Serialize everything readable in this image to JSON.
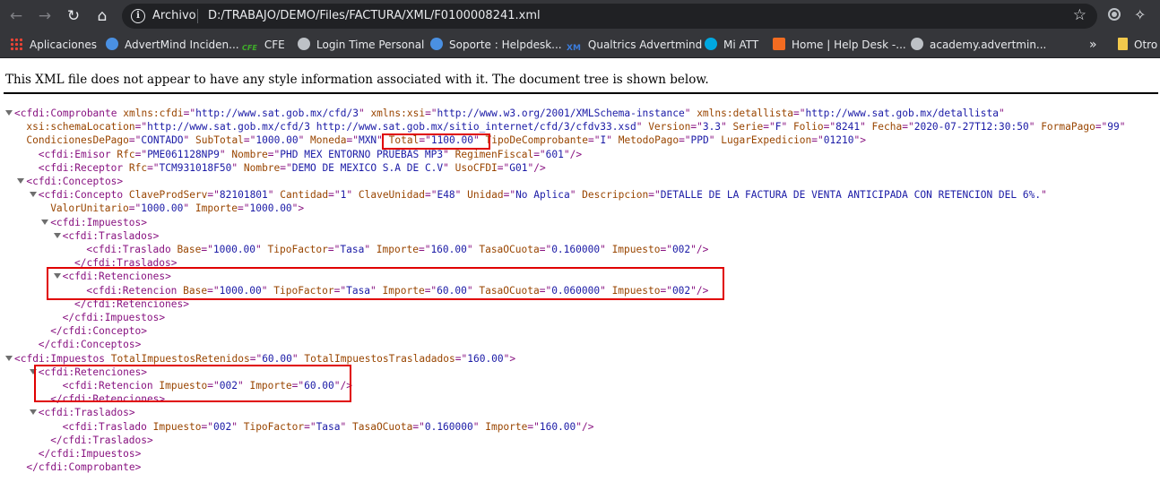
{
  "browser": {
    "omnibox_label": "Archivo",
    "url": "D:/TRABAJO/DEMO/Files/FACTURA/XML/F0100008241.xml"
  },
  "bookmarks": [
    "Aplicaciones",
    "AdvertMind Inciden...",
    "CFE",
    "Login Time Personal",
    "Soporte : Helpdesk...",
    "Qualtrics Advertmind",
    "Mi ATT",
    "Home | Help Desk -...",
    "academy.advertmin...",
    "Otro"
  ],
  "bookmark_overflow": "»",
  "bookmark_icon_labels": {
    "cfe": "CFE",
    "xm": "XM"
  },
  "page": {
    "header": "This XML file does not appear to have any style information associated with it. The document tree is shown below."
  },
  "xml_lines": [
    {
      "i": 0,
      "t": 1,
      "p": [
        [
          "tag",
          "<cfdi:Comprobante "
        ],
        [
          "an",
          "xmlns:cfdi"
        ],
        [
          "tag",
          "=\""
        ],
        [
          "av",
          "http://www.sat.gob.mx/cfd/3"
        ],
        [
          "tag",
          "\" "
        ],
        [
          "an",
          "xmlns:xsi"
        ],
        [
          "tag",
          "=\""
        ],
        [
          "av",
          "http://www.w3.org/2001/XMLSchema-instance"
        ],
        [
          "tag",
          "\" "
        ],
        [
          "an",
          "xmlns:detallista"
        ],
        [
          "tag",
          "=\""
        ],
        [
          "av",
          "http://www.sat.gob.mx/detallista"
        ],
        [
          "tag",
          "\""
        ]
      ]
    },
    {
      "i": 1,
      "t": 0,
      "p": [
        [
          "an",
          "xsi:schemaLocation"
        ],
        [
          "tag",
          "=\""
        ],
        [
          "av",
          "http://www.sat.gob.mx/cfd/3 http://www.sat.gob.mx/sitio_internet/cfd/3/cfdv33.xsd"
        ],
        [
          "tag",
          "\" "
        ],
        [
          "an",
          "Version"
        ],
        [
          "tag",
          "=\""
        ],
        [
          "av",
          "3.3"
        ],
        [
          "tag",
          "\" "
        ],
        [
          "an",
          "Serie"
        ],
        [
          "tag",
          "=\""
        ],
        [
          "av",
          "F"
        ],
        [
          "tag",
          "\" "
        ],
        [
          "an",
          "Folio"
        ],
        [
          "tag",
          "=\""
        ],
        [
          "av",
          "8241"
        ],
        [
          "tag",
          "\" "
        ],
        [
          "an",
          "Fecha"
        ],
        [
          "tag",
          "=\""
        ],
        [
          "av",
          "2020-07-27T12:30:50"
        ],
        [
          "tag",
          "\" "
        ],
        [
          "an",
          "FormaPago"
        ],
        [
          "tag",
          "=\""
        ],
        [
          "av",
          "99"
        ],
        [
          "tag",
          "\""
        ]
      ]
    },
    {
      "i": 1,
      "t": 0,
      "p": [
        [
          "an",
          "CondicionesDePago"
        ],
        [
          "tag",
          "=\""
        ],
        [
          "av",
          "CONTADO"
        ],
        [
          "tag",
          "\" "
        ],
        [
          "an",
          "SubTotal"
        ],
        [
          "tag",
          "=\""
        ],
        [
          "av",
          "1000.00"
        ],
        [
          "tag",
          "\" "
        ],
        [
          "an",
          "Moneda"
        ],
        [
          "tag",
          "=\""
        ],
        [
          "av",
          "MXN"
        ],
        [
          "tag",
          "\" "
        ],
        [
          "an",
          "Total"
        ],
        [
          "tag",
          "=\""
        ],
        [
          "av",
          "1100.00"
        ],
        [
          "tag",
          "\" "
        ],
        [
          "an",
          "TipoDeComprobante"
        ],
        [
          "tag",
          "=\""
        ],
        [
          "av",
          "I"
        ],
        [
          "tag",
          "\" "
        ],
        [
          "an",
          "MetodoPago"
        ],
        [
          "tag",
          "=\""
        ],
        [
          "av",
          "PPD"
        ],
        [
          "tag",
          "\" "
        ],
        [
          "an",
          "LugarExpedicion"
        ],
        [
          "tag",
          "=\""
        ],
        [
          "av",
          "01210"
        ],
        [
          "tag",
          "\">"
        ]
      ]
    },
    {
      "i": 2,
      "t": 0,
      "p": [
        [
          "tag",
          "<cfdi:Emisor "
        ],
        [
          "an",
          "Rfc"
        ],
        [
          "tag",
          "=\""
        ],
        [
          "av",
          "PME061128NP9"
        ],
        [
          "tag",
          "\" "
        ],
        [
          "an",
          "Nombre"
        ],
        [
          "tag",
          "=\""
        ],
        [
          "av",
          "PHD MEX ENTORNO PRUEBAS MP3"
        ],
        [
          "tag",
          "\" "
        ],
        [
          "an",
          "RegimenFiscal"
        ],
        [
          "tag",
          "=\""
        ],
        [
          "av",
          "601"
        ],
        [
          "tag",
          "\"/>"
        ]
      ]
    },
    {
      "i": 2,
      "t": 0,
      "p": [
        [
          "tag",
          "<cfdi:Receptor "
        ],
        [
          "an",
          "Rfc"
        ],
        [
          "tag",
          "=\""
        ],
        [
          "av",
          "TCM931018F50"
        ],
        [
          "tag",
          "\" "
        ],
        [
          "an",
          "Nombre"
        ],
        [
          "tag",
          "=\""
        ],
        [
          "av",
          "DEMO DE MEXICO S.A DE C.V"
        ],
        [
          "tag",
          "\" "
        ],
        [
          "an",
          "UsoCFDI"
        ],
        [
          "tag",
          "=\""
        ],
        [
          "av",
          "G01"
        ],
        [
          "tag",
          "\"/>"
        ]
      ]
    },
    {
      "i": 1,
      "t": 1,
      "p": [
        [
          "tag",
          "<cfdi:Conceptos>"
        ]
      ]
    },
    {
      "i": 2,
      "t": 1,
      "p": [
        [
          "tag",
          "<cfdi:Concepto "
        ],
        [
          "an",
          "ClaveProdServ"
        ],
        [
          "tag",
          "=\""
        ],
        [
          "av",
          "82101801"
        ],
        [
          "tag",
          "\" "
        ],
        [
          "an",
          "Cantidad"
        ],
        [
          "tag",
          "=\""
        ],
        [
          "av",
          "1"
        ],
        [
          "tag",
          "\" "
        ],
        [
          "an",
          "ClaveUnidad"
        ],
        [
          "tag",
          "=\""
        ],
        [
          "av",
          "E48"
        ],
        [
          "tag",
          "\" "
        ],
        [
          "an",
          "Unidad"
        ],
        [
          "tag",
          "=\""
        ],
        [
          "av",
          "No Aplica"
        ],
        [
          "tag",
          "\" "
        ],
        [
          "an",
          "Descripcion"
        ],
        [
          "tag",
          "=\""
        ],
        [
          "av",
          "DETALLE DE LA FACTURA DE VENTA ANTICIPADA CON RETENCION DEL 6%."
        ],
        [
          "tag",
          "\""
        ]
      ]
    },
    {
      "i": 3,
      "t": 0,
      "p": [
        [
          "an",
          "ValorUnitario"
        ],
        [
          "tag",
          "=\""
        ],
        [
          "av",
          "1000.00"
        ],
        [
          "tag",
          "\" "
        ],
        [
          "an",
          "Importe"
        ],
        [
          "tag",
          "=\""
        ],
        [
          "av",
          "1000.00"
        ],
        [
          "tag",
          "\">"
        ]
      ]
    },
    {
      "i": 3,
      "t": 1,
      "p": [
        [
          "tag",
          "<cfdi:Impuestos>"
        ]
      ]
    },
    {
      "i": 4,
      "t": 1,
      "p": [
        [
          "tag",
          "<cfdi:Traslados>"
        ]
      ]
    },
    {
      "i": 6,
      "t": 0,
      "p": [
        [
          "tag",
          "<cfdi:Traslado "
        ],
        [
          "an",
          "Base"
        ],
        [
          "tag",
          "=\""
        ],
        [
          "av",
          "1000.00"
        ],
        [
          "tag",
          "\" "
        ],
        [
          "an",
          "TipoFactor"
        ],
        [
          "tag",
          "=\""
        ],
        [
          "av",
          "Tasa"
        ],
        [
          "tag",
          "\" "
        ],
        [
          "an",
          "Importe"
        ],
        [
          "tag",
          "=\""
        ],
        [
          "av",
          "160.00"
        ],
        [
          "tag",
          "\" "
        ],
        [
          "an",
          "TasaOCuota"
        ],
        [
          "tag",
          "=\""
        ],
        [
          "av",
          "0.160000"
        ],
        [
          "tag",
          "\" "
        ],
        [
          "an",
          "Impuesto"
        ],
        [
          "tag",
          "=\""
        ],
        [
          "av",
          "002"
        ],
        [
          "tag",
          "\"/>"
        ]
      ]
    },
    {
      "i": 5,
      "t": 0,
      "p": [
        [
          "tag",
          "</cfdi:Traslados>"
        ]
      ]
    },
    {
      "i": 4,
      "t": 1,
      "p": [
        [
          "tag",
          "<cfdi:Retenciones>"
        ]
      ]
    },
    {
      "i": 6,
      "t": 0,
      "p": [
        [
          "tag",
          "<cfdi:Retencion "
        ],
        [
          "an",
          "Base"
        ],
        [
          "tag",
          "=\""
        ],
        [
          "av",
          "1000.00"
        ],
        [
          "tag",
          "\" "
        ],
        [
          "an",
          "TipoFactor"
        ],
        [
          "tag",
          "=\""
        ],
        [
          "av",
          "Tasa"
        ],
        [
          "tag",
          "\" "
        ],
        [
          "an",
          "Importe"
        ],
        [
          "tag",
          "=\""
        ],
        [
          "av",
          "60.00"
        ],
        [
          "tag",
          "\" "
        ],
        [
          "an",
          "TasaOCuota"
        ],
        [
          "tag",
          "=\""
        ],
        [
          "av",
          "0.060000"
        ],
        [
          "tag",
          "\" "
        ],
        [
          "an",
          "Impuesto"
        ],
        [
          "tag",
          "=\""
        ],
        [
          "av",
          "002"
        ],
        [
          "tag",
          "\"/>"
        ]
      ]
    },
    {
      "i": 5,
      "t": 0,
      "p": [
        [
          "tag",
          "</cfdi:Retenciones>"
        ]
      ]
    },
    {
      "i": 4,
      "t": 0,
      "p": [
        [
          "tag",
          "</cfdi:Impuestos>"
        ]
      ]
    },
    {
      "i": 3,
      "t": 0,
      "p": [
        [
          "tag",
          "</cfdi:Concepto>"
        ]
      ]
    },
    {
      "i": 2,
      "t": 0,
      "p": [
        [
          "tag",
          "</cfdi:Conceptos>"
        ]
      ]
    },
    {
      "i": 0,
      "t": 1,
      "p": [
        [
          "tag",
          "<cfdi:Impuestos "
        ],
        [
          "an",
          "TotalImpuestosRetenidos"
        ],
        [
          "tag",
          "=\""
        ],
        [
          "av",
          "60.00"
        ],
        [
          "tag",
          "\" "
        ],
        [
          "an",
          "TotalImpuestosTrasladados"
        ],
        [
          "tag",
          "=\""
        ],
        [
          "av",
          "160.00"
        ],
        [
          "tag",
          "\">"
        ]
      ]
    },
    {
      "i": 2,
      "t": 1,
      "p": [
        [
          "tag",
          "<cfdi:Retenciones>"
        ]
      ]
    },
    {
      "i": 4,
      "t": 0,
      "p": [
        [
          "tag",
          "<cfdi:Retencion "
        ],
        [
          "an",
          "Impuesto"
        ],
        [
          "tag",
          "=\""
        ],
        [
          "av",
          "002"
        ],
        [
          "tag",
          "\" "
        ],
        [
          "an",
          "Importe"
        ],
        [
          "tag",
          "=\""
        ],
        [
          "av",
          "60.00"
        ],
        [
          "tag",
          "\"/>"
        ]
      ]
    },
    {
      "i": 3,
      "t": 0,
      "p": [
        [
          "tag",
          "</cfdi:Retenciones>"
        ]
      ]
    },
    {
      "i": 2,
      "t": 1,
      "p": [
        [
          "tag",
          "<cfdi:Traslados>"
        ]
      ]
    },
    {
      "i": 4,
      "t": 0,
      "p": [
        [
          "tag",
          "<cfdi:Traslado "
        ],
        [
          "an",
          "Impuesto"
        ],
        [
          "tag",
          "=\""
        ],
        [
          "av",
          "002"
        ],
        [
          "tag",
          "\" "
        ],
        [
          "an",
          "TipoFactor"
        ],
        [
          "tag",
          "=\""
        ],
        [
          "av",
          "Tasa"
        ],
        [
          "tag",
          "\" "
        ],
        [
          "an",
          "TasaOCuota"
        ],
        [
          "tag",
          "=\""
        ],
        [
          "av",
          "0.160000"
        ],
        [
          "tag",
          "\" "
        ],
        [
          "an",
          "Importe"
        ],
        [
          "tag",
          "=\""
        ],
        [
          "av",
          "160.00"
        ],
        [
          "tag",
          "\"/>"
        ]
      ]
    },
    {
      "i": 3,
      "t": 0,
      "p": [
        [
          "tag",
          "</cfdi:Traslados>"
        ]
      ]
    },
    {
      "i": 2,
      "t": 0,
      "p": [
        [
          "tag",
          "</cfdi:Impuestos>"
        ]
      ]
    },
    {
      "i": 1,
      "t": 0,
      "p": [
        [
          "tag",
          "</cfdi:Comprobante>"
        ]
      ]
    }
  ],
  "annotation_color": "#e00000"
}
